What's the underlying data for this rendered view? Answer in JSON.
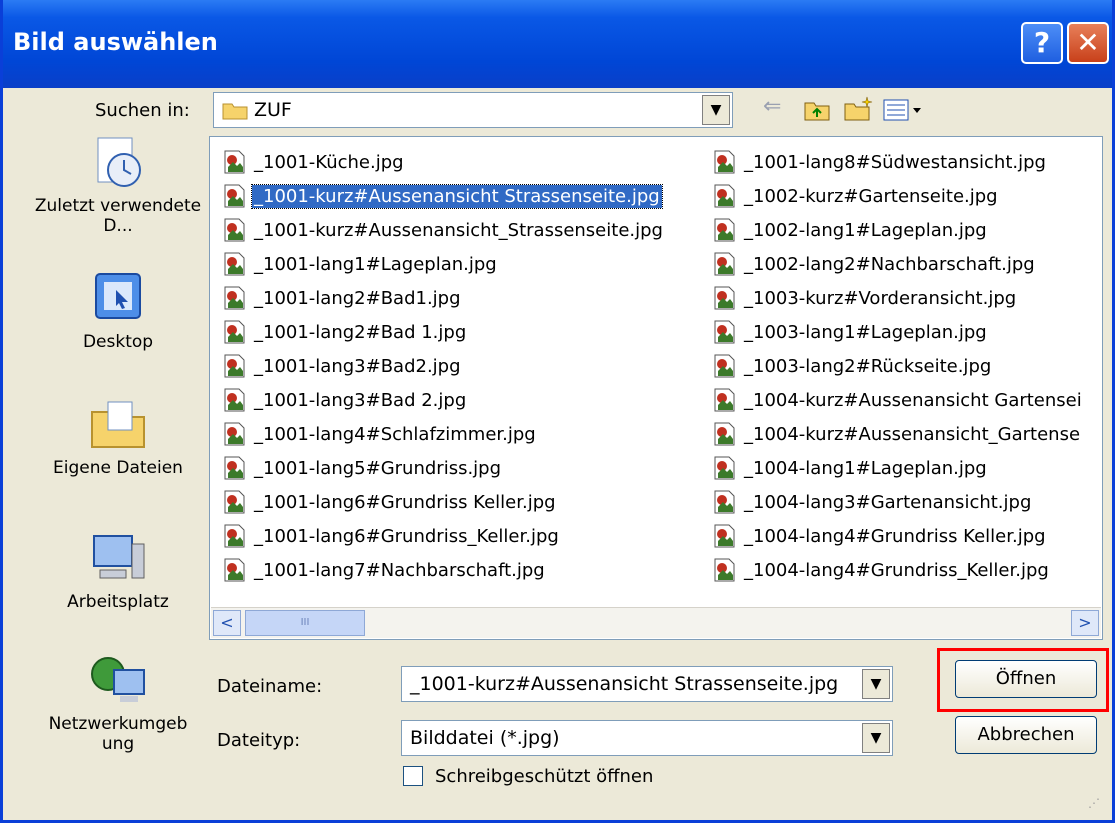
{
  "window": {
    "title": "Bild auswählen",
    "help_label": "?",
    "close_label": "✕"
  },
  "lookin": {
    "label": "Suchen in:",
    "value": "ZUF"
  },
  "places": [
    {
      "label": "Zuletzt verwendete D...",
      "icon": "recent-documents-icon"
    },
    {
      "label": "Desktop",
      "icon": "desktop-icon"
    },
    {
      "label": "Eigene Dateien",
      "icon": "my-documents-icon"
    },
    {
      "label": "Arbeitsplatz",
      "icon": "my-computer-icon"
    },
    {
      "label": "Netzwerkumgeb ung",
      "icon": "network-icon"
    }
  ],
  "files_left": [
    "_1001-Küche.jpg",
    "_1001-kurz#Aussenansicht Strassenseite.jpg",
    "_1001-kurz#Aussenansicht_Strassenseite.jpg",
    "_1001-lang1#Lageplan.jpg",
    "_1001-lang2#Bad1.jpg",
    "_1001-lang2#Bad 1.jpg",
    "_1001-lang3#Bad2.jpg",
    "_1001-lang3#Bad 2.jpg",
    "_1001-lang4#Schlafzimmer.jpg",
    "_1001-lang5#Grundriss.jpg",
    "_1001-lang6#Grundriss Keller.jpg",
    "_1001-lang6#Grundriss_Keller.jpg",
    "_1001-lang7#Nachbarschaft.jpg"
  ],
  "files_right": [
    "_1001-lang8#Südwestansicht.jpg",
    "_1002-kurz#Gartenseite.jpg",
    "_1002-lang1#Lageplan.jpg",
    "_1002-lang2#Nachbarschaft.jpg",
    "_1003-kurz#Vorderansicht.jpg",
    "_1003-lang1#Lageplan.jpg",
    "_1003-lang2#Rückseite.jpg",
    "_1004-kurz#Aussenansicht Gartensei",
    "_1004-kurz#Aussenansicht_Gartense",
    "_1004-lang1#Lageplan.jpg",
    "_1004-lang3#Gartenansicht.jpg",
    "_1004-lang4#Grundriss Keller.jpg",
    "_1004-lang4#Grundriss_Keller.jpg"
  ],
  "selected_file": "_1001-kurz#Aussenansicht Strassenseite.jpg",
  "filename": {
    "label": "Dateiname:",
    "value": "_1001-kurz#Aussenansicht Strassenseite.jpg"
  },
  "filetype": {
    "label": "Dateityp:",
    "value": "Bilddatei (*.jpg)"
  },
  "readonly": {
    "label": "Schreibgeschützt öffnen",
    "checked": false
  },
  "buttons": {
    "open": "Öffnen",
    "cancel": "Abbrechen"
  },
  "scroll": {
    "left": "<",
    "right": ">",
    "thumb": "III"
  },
  "colors": {
    "title_bar": "#0046d6",
    "selection": "#316ac5",
    "highlight_box": "#ff0000"
  }
}
